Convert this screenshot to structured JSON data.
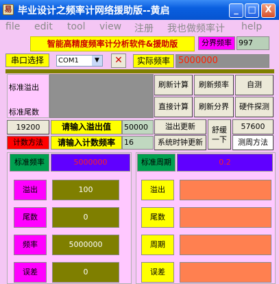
{
  "window": {
    "title": "毕业设计之频率计网络援助版--黄启",
    "app_icon_glyph": "易",
    "minimize": "_",
    "maximize": "□",
    "close": "X"
  },
  "menu": [
    "file",
    "edit",
    "tool",
    "view",
    "注册",
    "我也做频率计",
    "help"
  ],
  "banner": "智能高精度频率计分析软件&援助版",
  "boundary": {
    "label": "分界频率",
    "value": "997"
  },
  "serial": {
    "label": "串口选择",
    "port": "COM1",
    "arrow": "▼",
    "clear": "✕"
  },
  "actual": {
    "label": "实际频率",
    "value": "5000000"
  },
  "std_overflow_label": "标准溢出",
  "std_tail_label": "标准尾数",
  "buttons": {
    "refresh_calc": "刷新计算",
    "refresh_freq": "刷新频率",
    "self_test": "自测",
    "direct_calc": "直接计算",
    "refresh_boundary": "刷新分界",
    "hw_detect": "硬件探测",
    "overflow_update": "溢出更新",
    "clock_update": "系统时钟更新",
    "relax": "舒缓一下",
    "baud2": "57600",
    "measure_method": "测周方法"
  },
  "row_overflow": {
    "value": "19200",
    "prompt": "请输入溢出值",
    "input": "50000"
  },
  "row_count": {
    "label": "计数方法",
    "prompt": "请输入计数频率",
    "input": "16"
  },
  "std_freq": {
    "label": "标准频率",
    "value": "5000000"
  },
  "std_period": {
    "label": "标准周期",
    "value": "0.2"
  },
  "left_panel": [
    {
      "label": "溢出",
      "value": "100"
    },
    {
      "label": "尾数",
      "value": "0"
    },
    {
      "label": "频率",
      "value": "5000000"
    },
    {
      "label": "误差",
      "value": "0"
    }
  ],
  "right_panel": [
    {
      "label": "溢出",
      "value": ""
    },
    {
      "label": "尾数",
      "value": ""
    },
    {
      "label": "周期",
      "value": ""
    },
    {
      "label": "误差",
      "value": ""
    }
  ]
}
